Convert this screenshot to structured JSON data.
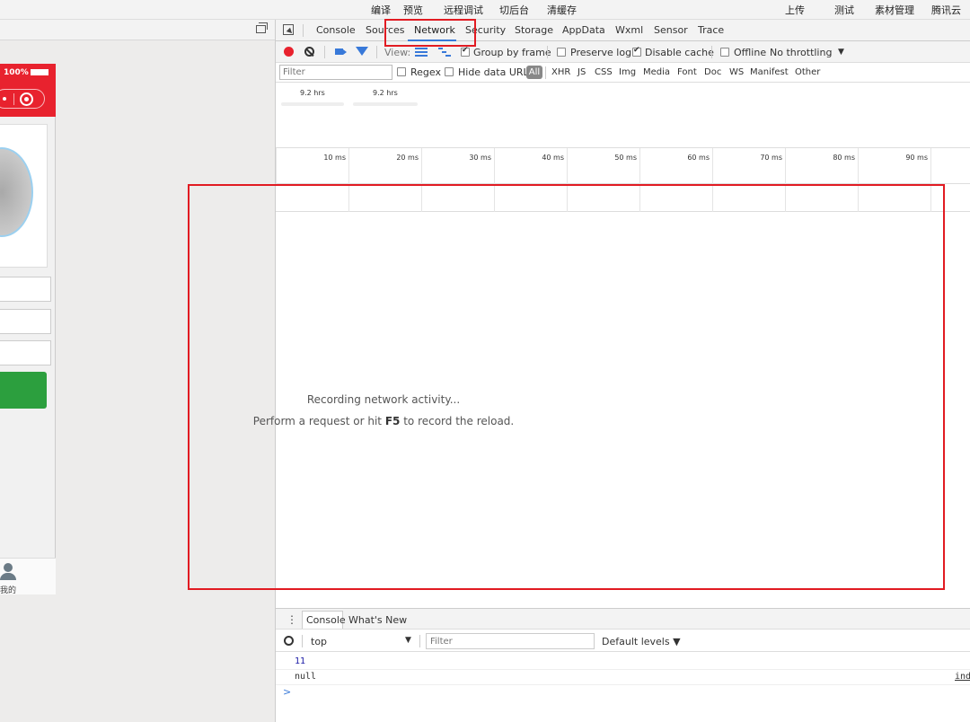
{
  "menu": [
    "编译",
    "预览",
    "远程调试",
    "切后台",
    "清缓存",
    "上传",
    "测试",
    "素材管理",
    "腾讯云"
  ],
  "simulator": {
    "battery": "100%",
    "tab_label": "我的"
  },
  "devtools": {
    "tabs": [
      "Console",
      "Sources",
      "Network",
      "Security",
      "Storage",
      "AppData",
      "Wxml",
      "Sensor",
      "Trace"
    ],
    "active_tab": "Network",
    "toolbar": {
      "view_label": "View:",
      "group_by_frame": "Group by frame",
      "preserve_log": "Preserve log",
      "disable_cache": "Disable cache",
      "offline": "Offline",
      "throttling": "No throttling"
    },
    "filter": {
      "placeholder": "Filter",
      "regex": "Regex",
      "hide_data_urls": "Hide data URLs",
      "all": "All",
      "types": [
        "XHR",
        "JS",
        "CSS",
        "Img",
        "Media",
        "Font",
        "Doc",
        "WS",
        "Manifest",
        "Other"
      ]
    },
    "overview": {
      "labels": [
        "9.2 hrs",
        "9.2 hrs"
      ]
    },
    "timeline": {
      "ticks": [
        "10 ms",
        "20 ms",
        "30 ms",
        "40 ms",
        "50 ms",
        "60 ms",
        "70 ms",
        "80 ms",
        "90 ms"
      ]
    },
    "empty": {
      "line1": "Recording network activity...",
      "line2_prefix": "Perform a request or hit ",
      "line2_key": "F5",
      "line2_suffix": " to record the reload."
    },
    "drawer": {
      "tabs": [
        "Console",
        "What's New"
      ],
      "context": "top",
      "filter_placeholder": "Filter",
      "levels": "Default levels",
      "logs": [
        {
          "text": "11",
          "color": "#1a1aa6",
          "source": ""
        },
        {
          "text": "null",
          "color": "#333333",
          "source": "inde"
        }
      ],
      "prompt": ">"
    }
  }
}
